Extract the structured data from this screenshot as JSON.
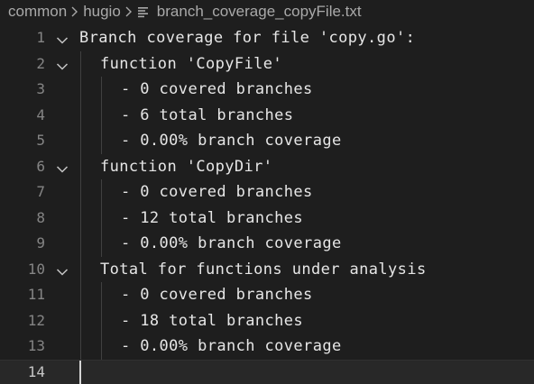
{
  "breadcrumb": {
    "items": [
      "common",
      "hugio"
    ],
    "file_name": "branch_coverage_copyFile.txt"
  },
  "editor": {
    "lines": [
      {
        "number": "1",
        "text": "Branch coverage for file 'copy.go':",
        "indent": 0,
        "foldable": true
      },
      {
        "number": "2",
        "text": "function 'CopyFile'",
        "indent": 1,
        "foldable": true
      },
      {
        "number": "3",
        "text": "- 0 covered branches",
        "indent": 2,
        "foldable": false
      },
      {
        "number": "4",
        "text": "- 6 total branches",
        "indent": 2,
        "foldable": false
      },
      {
        "number": "5",
        "text": "- 0.00% branch coverage",
        "indent": 2,
        "foldable": false
      },
      {
        "number": "6",
        "text": "function 'CopyDir'",
        "indent": 1,
        "foldable": true
      },
      {
        "number": "7",
        "text": "- 0 covered branches",
        "indent": 2,
        "foldable": false
      },
      {
        "number": "8",
        "text": "- 12 total branches",
        "indent": 2,
        "foldable": false
      },
      {
        "number": "9",
        "text": "- 0.00% branch coverage",
        "indent": 2,
        "foldable": false
      },
      {
        "number": "10",
        "text": "Total for functions under analysis",
        "indent": 1,
        "foldable": true
      },
      {
        "number": "11",
        "text": "- 0 covered branches",
        "indent": 2,
        "foldable": false
      },
      {
        "number": "12",
        "text": "- 18 total branches",
        "indent": 2,
        "foldable": false
      },
      {
        "number": "13",
        "text": "- 0.00% branch coverage",
        "indent": 2,
        "foldable": false
      },
      {
        "number": "14",
        "text": "",
        "indent": 0,
        "foldable": false,
        "current": true
      }
    ]
  },
  "colors": {
    "background": "#1e1e1e",
    "text": "#e6e6e6",
    "line_number": "#858585",
    "current_line": "#282828",
    "indent_guide": "#404040"
  },
  "icons": {
    "separator": "chevron-right-icon",
    "file": "text-file-icon",
    "fold": "chevron-down-icon"
  }
}
